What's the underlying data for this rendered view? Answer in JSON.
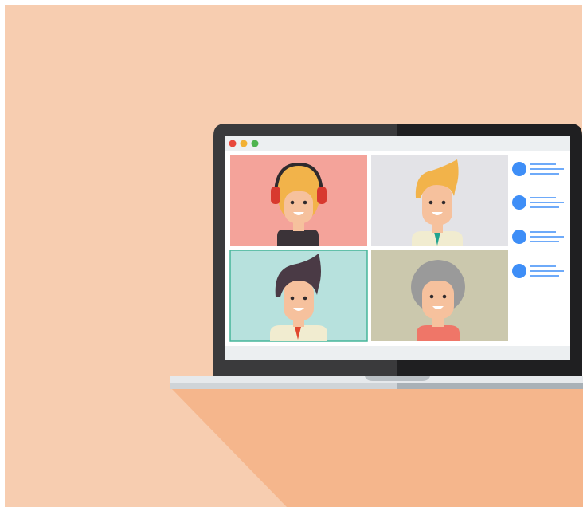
{
  "illustration": {
    "subject": "video-conference-on-laptop",
    "colors": {
      "background": "#f7cdb0",
      "shadow": "#f5b68c",
      "laptop_bezel_light": "#3a3a3c",
      "laptop_bezel_dark": "#1f1f21",
      "window_bar": "#eceff1",
      "dot_red": "#e8483c",
      "dot_yellow": "#f2b134",
      "dot_green": "#4fb44f",
      "tile_1": "#f4a39a",
      "tile_2": "#e3e3e7",
      "tile_3": "#b7e1dd",
      "tile_3_border": "#46b59a",
      "tile_4": "#cbc8ad",
      "accent_blue": "#3e8ef7",
      "skin": "#f6c19d"
    },
    "participants": [
      {
        "id": "p1",
        "hair": "#f2b34a",
        "shirt": "#3b3338",
        "accessory": "headphones"
      },
      {
        "id": "p2",
        "hair": "#f2b34a",
        "shirt": "#f1ecd0",
        "accessory": "teal-tie"
      },
      {
        "id": "p3",
        "hair": "#4a3a45",
        "shirt": "#f1ecd0",
        "accessory": "red-tie",
        "active": true
      },
      {
        "id": "p4",
        "hair": "#9a9a9a",
        "shirt": "#ef7668",
        "accessory": "none"
      }
    ],
    "chat_entries": 4
  }
}
